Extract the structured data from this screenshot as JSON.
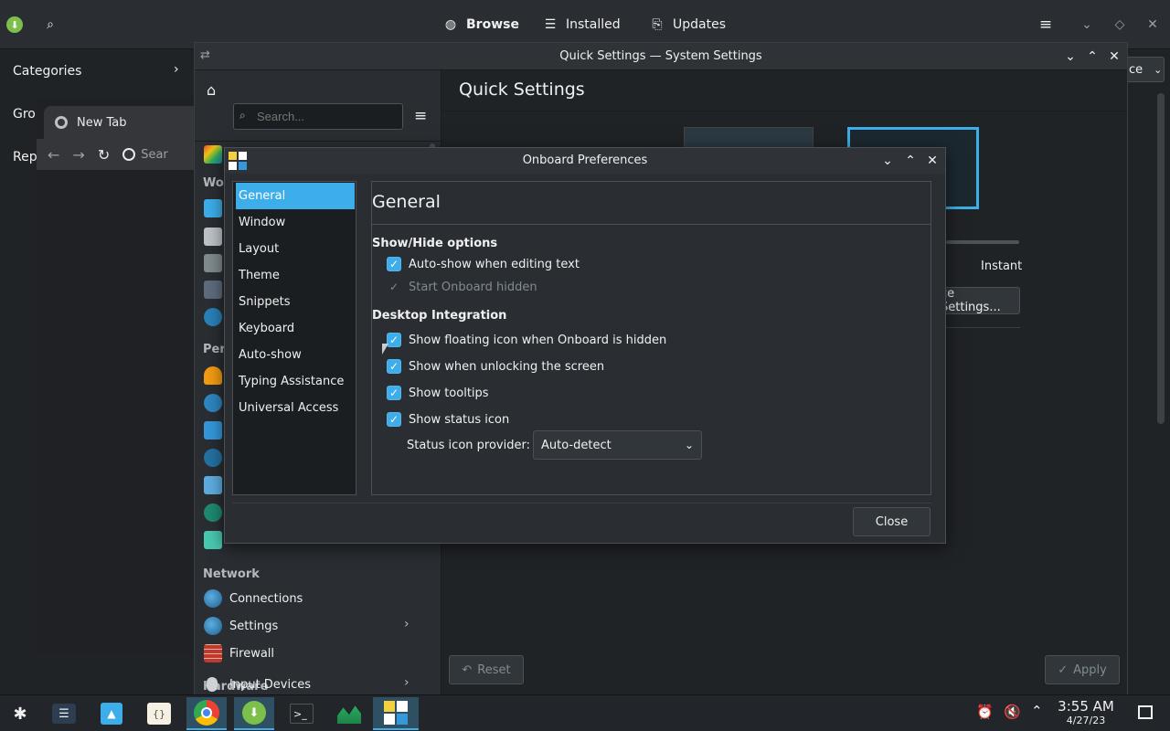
{
  "discover": {
    "tabs": [
      "Browse",
      "Installed",
      "Updates"
    ],
    "sidebar": {
      "categories": "Categories",
      "item2": "Grou",
      "item3": "Rep"
    },
    "combo_text": "ce"
  },
  "chrome": {
    "tab_title": "New Tab",
    "search_partial": "Sear"
  },
  "system_settings": {
    "window_title": "Quick Settings — System Settings",
    "search_placeholder": "Search...",
    "page_title": "Quick Settings",
    "partial_section": "Wor",
    "partial_personal": "Pers",
    "network_header": "Network",
    "network_items": [
      "Connections",
      "Settings",
      "Firewall"
    ],
    "hardware_header": "Hardware",
    "hardware_item": "Input Devices",
    "instant_label": "Instant",
    "settings_button": "ce Settings...",
    "reset_button": "Reset",
    "apply_button": "Apply"
  },
  "onboard": {
    "window_title": "Onboard Preferences",
    "nav": [
      "General",
      "Window",
      "Layout",
      "Theme",
      "Snippets",
      "Keyboard",
      "Auto-show",
      "Typing Assistance",
      "Universal Access"
    ],
    "page_title": "General",
    "showhide_header": "Show/Hide options",
    "auto_show": "Auto-show when editing text",
    "start_hidden": "Start Onboard hidden",
    "desktop_header": "Desktop Integration",
    "floating_icon": "Show floating icon when Onboard is hidden",
    "unlock": "Show when unlocking the screen",
    "tooltips": "Show tooltips",
    "status_icon": "Show status icon",
    "provider_label": "Status icon provider:",
    "provider_value": "Auto-detect",
    "close_button": "Close"
  },
  "clock": {
    "time": "3:55 AM",
    "date": "4/27/23"
  },
  "colors": {
    "accent": "#3daee9",
    "panel": "#222529",
    "window": "#2a2e32"
  }
}
